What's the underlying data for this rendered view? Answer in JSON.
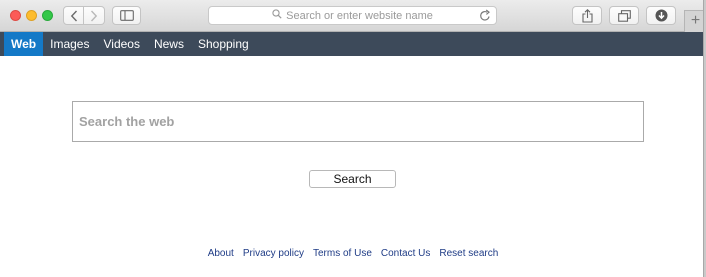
{
  "browser": {
    "address_placeholder": "Search or enter website name",
    "new_tab_symbol": "+",
    "icons": {
      "back": "chevron-left-icon",
      "forward": "chevron-right-icon",
      "sidebar": "sidebar-icon",
      "search": "magnifier-icon",
      "reload": "reload-icon",
      "share": "share-icon",
      "tabs": "tabs-overview-icon",
      "download": "download-icon"
    }
  },
  "nav": {
    "items": [
      {
        "label": "Web",
        "active": true
      },
      {
        "label": "Images"
      },
      {
        "label": "Videos"
      },
      {
        "label": "News"
      },
      {
        "label": "Shopping"
      }
    ],
    "bar_color": "#3d4a5a",
    "active_color": "#1479c7"
  },
  "search": {
    "placeholder": "Search the web",
    "button_label": "Search"
  },
  "footer": {
    "links": [
      "About",
      "Privacy policy",
      "Terms of Use",
      "Contact Us",
      "Reset search"
    ],
    "link_color": "#1f3c86"
  }
}
